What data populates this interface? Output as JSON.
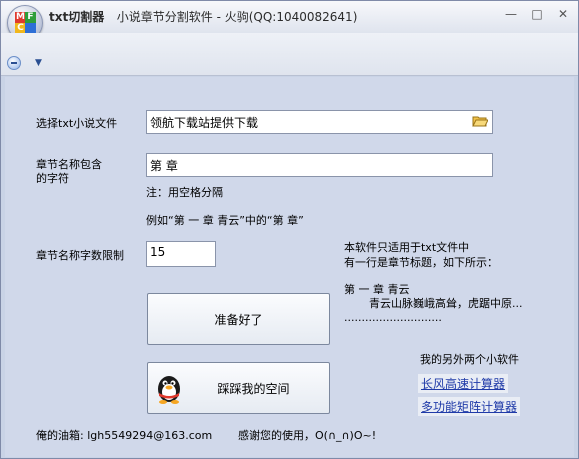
{
  "window": {
    "title_main": "txt切割器",
    "title_sub": "小说章节分割软件 - 火驹(QQ:1040082641)"
  },
  "form": {
    "file_label": "选择txt小说文件",
    "file_value": "领航下载站提供下载",
    "chapter_label_1": "章节名称包含",
    "chapter_label_2": "的字符",
    "chapter_value": "第 章",
    "note": "注：用空格分隔",
    "example": "例如“第 一 章  青云”中的“第 章”",
    "limit_label": "章节名称字数限制",
    "limit_value": "15"
  },
  "buttons": {
    "ready_label": "准备好了",
    "qq_label": "踩踩我的空间"
  },
  "info": {
    "line1": "本软件只适用于txt文件中",
    "line2": "有一行是章节标题，如下所示：",
    "sample_title": "第 一 章  青云",
    "sample_text": "青云山脉巍峨高耸，虎踞中原...",
    "sample_dots": "............................"
  },
  "other_apps": {
    "heading": "我的另外两个小软件",
    "link1": "长风高速计算器",
    "link2": "多功能矩阵计算器"
  },
  "footer": {
    "email": "俺的油箱: lgh5549294@163.com",
    "thanks": "感谢您的使用，O(∩_∩)O~!"
  },
  "colors": {
    "accent": "#1f3aa8",
    "background": "#d0d8ea"
  }
}
